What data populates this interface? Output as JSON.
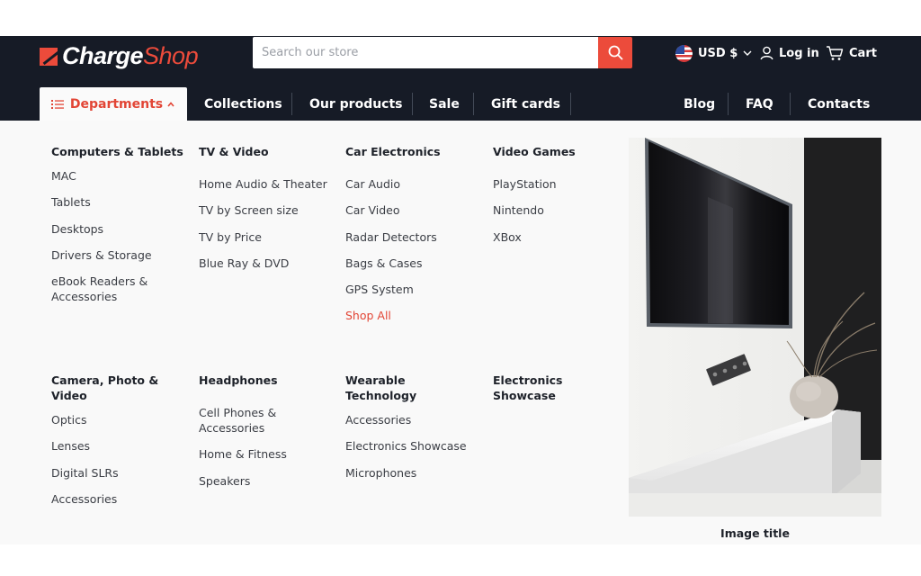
{
  "brand": {
    "name_part1": "Charge",
    "name_part2": "Shop",
    "accent": "#ec4b3b",
    "header_bg": "#161b26"
  },
  "search": {
    "placeholder": "Search our store",
    "value": ""
  },
  "header": {
    "currency": "USD $",
    "login": "Log in",
    "cart": "Cart"
  },
  "nav": {
    "departments": "Departments",
    "left_items": [
      "Collections",
      "Our products",
      "Sale",
      "Gift cards"
    ],
    "right_items": [
      "Blog",
      "FAQ",
      "Contacts"
    ]
  },
  "menu": {
    "columns": [
      {
        "title": "Computers & Tablets",
        "items": [
          "MAC",
          "Tablets",
          "Desktops",
          "Drivers & Storage",
          "eBook Readers & Accessories"
        ]
      },
      {
        "title": "TV & Video",
        "items": [
          "Home Audio & Theater",
          "TV by Screen size",
          "TV by Price",
          "Blue Ray & DVD"
        ]
      },
      {
        "title": "Car Electronics",
        "items": [
          "Car Audio",
          "Car Video",
          "Radar Detectors",
          "Bags & Cases",
          "GPS System",
          "Shop All"
        ]
      },
      {
        "title": "Video Games",
        "items": [
          "PlayStation",
          "Nintendo",
          "XBox"
        ]
      },
      {
        "title": "Camera, Photo & Video",
        "items": [
          "Optics",
          "Lenses",
          "Digital SLRs",
          "Accessories"
        ]
      },
      {
        "title": "Headphones",
        "items": [
          "Cell Phones & Accessories",
          "Home & Fitness",
          "Speakers"
        ]
      },
      {
        "title": "Wearable Technology",
        "items": [
          "Accessories",
          "Electronics Showcase",
          "Microphones"
        ]
      },
      {
        "title": "Electronics Showcase",
        "items": []
      }
    ],
    "image_caption": "Image title"
  }
}
